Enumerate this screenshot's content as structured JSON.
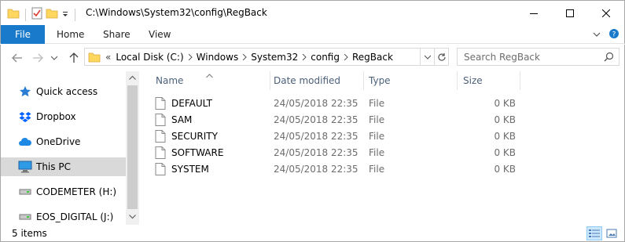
{
  "window": {
    "title": "C:\\Windows\\System32\\config\\RegBack"
  },
  "ribbon": {
    "tabs": [
      {
        "label": "File"
      },
      {
        "label": "Home"
      },
      {
        "label": "Share"
      },
      {
        "label": "View"
      }
    ]
  },
  "address": {
    "prefix": "«",
    "crumbs": [
      {
        "label": "Local Disk (C:)"
      },
      {
        "label": "Windows"
      },
      {
        "label": "System32"
      },
      {
        "label": "config"
      },
      {
        "label": "RegBack"
      }
    ]
  },
  "search": {
    "placeholder": "Search RegBack"
  },
  "sidebar": {
    "items": [
      {
        "label": "Quick access",
        "icon": "star-icon"
      },
      {
        "label": "Dropbox",
        "icon": "dropbox-icon"
      },
      {
        "label": "OneDrive",
        "icon": "onedrive-icon"
      },
      {
        "label": "This PC",
        "icon": "computer-icon",
        "selected": true
      },
      {
        "label": "CODEMETER (H:)",
        "icon": "drive-icon"
      },
      {
        "label": "EOS_DIGITAL (J:)",
        "icon": "drive-icon"
      }
    ]
  },
  "columns": {
    "name": "Name",
    "date": "Date modified",
    "type": "Type",
    "size": "Size"
  },
  "files": [
    {
      "name": "DEFAULT",
      "date": "24/05/2018 22:35",
      "type": "File",
      "size": "0 KB"
    },
    {
      "name": "SAM",
      "date": "24/05/2018 22:35",
      "type": "File",
      "size": "0 KB"
    },
    {
      "name": "SECURITY",
      "date": "24/05/2018 22:35",
      "type": "File",
      "size": "0 KB"
    },
    {
      "name": "SOFTWARE",
      "date": "24/05/2018 22:35",
      "type": "File",
      "size": "0 KB"
    },
    {
      "name": "SYSTEM",
      "date": "24/05/2018 22:35",
      "type": "File",
      "size": "0 KB"
    }
  ],
  "status": {
    "count": "5 items"
  },
  "colors": {
    "accent": "#1979ca",
    "header_text": "#4c607a",
    "selection": "#d9d9d9"
  }
}
